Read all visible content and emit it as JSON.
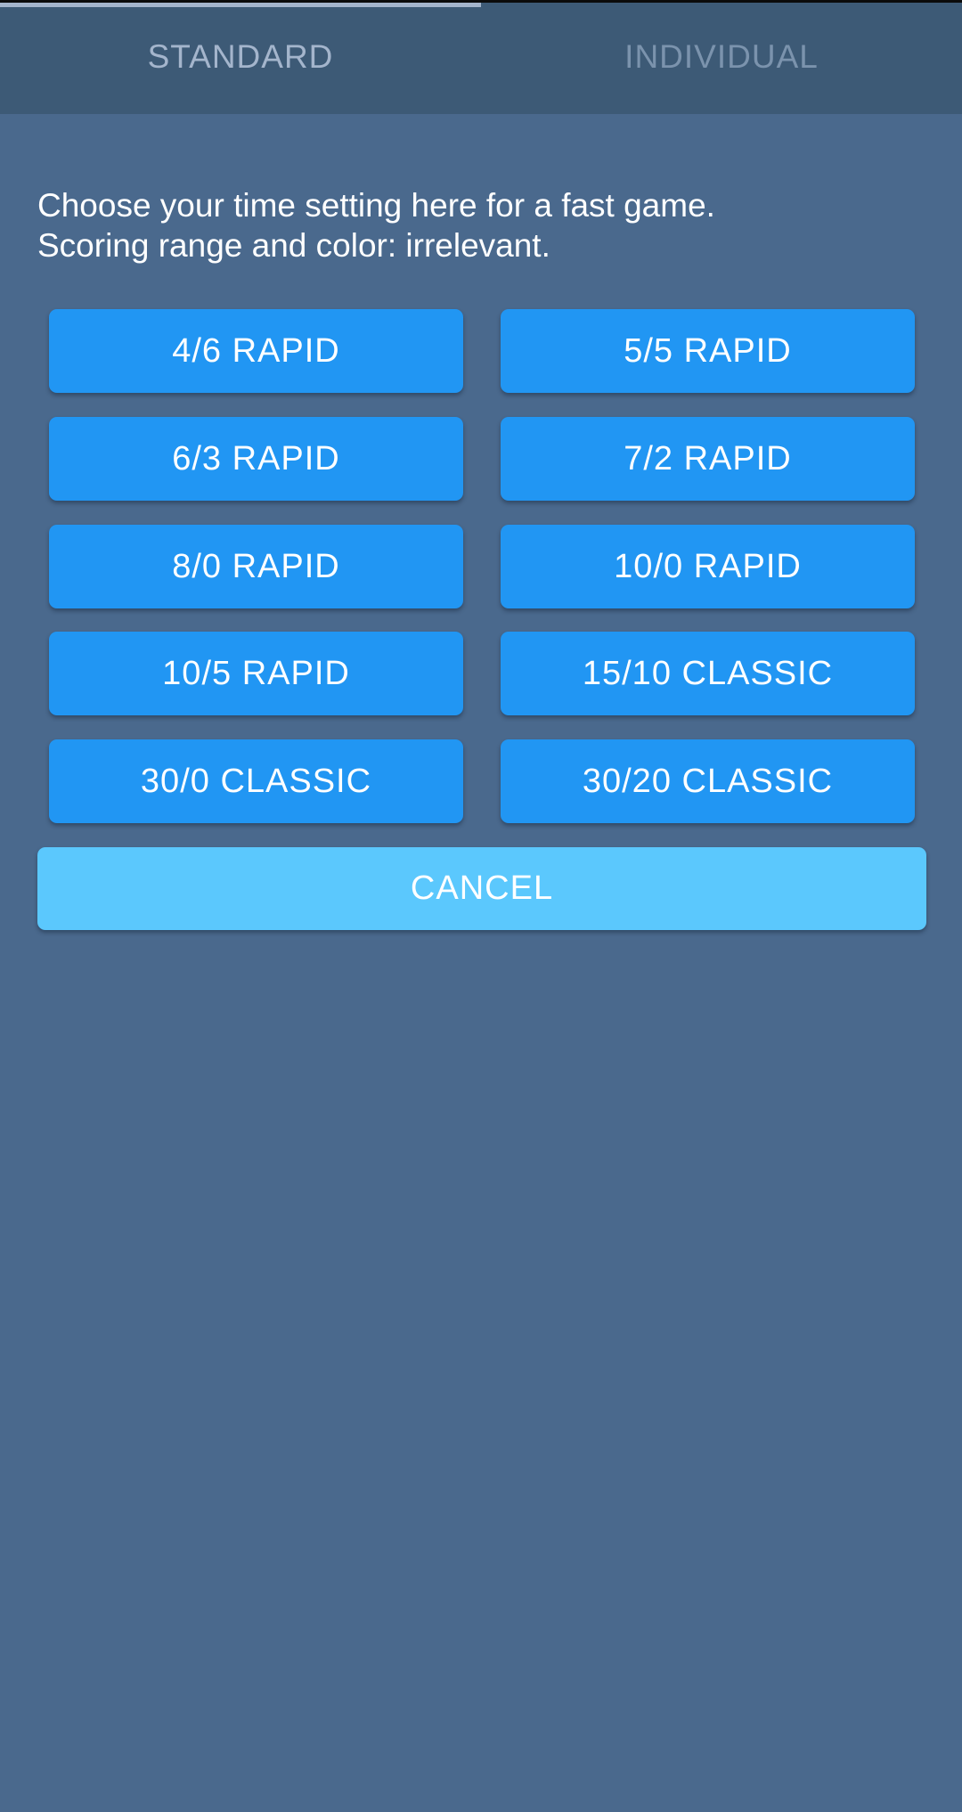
{
  "tabs": [
    {
      "label": "STANDARD",
      "active": true
    },
    {
      "label": "INDIVIDUAL",
      "active": false
    }
  ],
  "intro": {
    "line1": "Choose your time setting here for a fast game.",
    "line2": "Scoring range and color: irrelevant."
  },
  "time_options": [
    {
      "label": "4/6 RAPID"
    },
    {
      "label": "5/5 RAPID"
    },
    {
      "label": "6/3 RAPID"
    },
    {
      "label": "7/2 RAPID"
    },
    {
      "label": "8/0 RAPID"
    },
    {
      "label": "10/0 RAPID"
    },
    {
      "label": "10/5 RAPID"
    },
    {
      "label": "15/10 CLASSIC"
    },
    {
      "label": "30/0 CLASSIC"
    },
    {
      "label": "30/20 CLASSIC"
    }
  ],
  "cancel_label": "CANCEL",
  "colors": {
    "background": "#4a698d",
    "tab_bar": "#3d5a76",
    "option_button": "#2196f3",
    "cancel_button": "#5bc8fd"
  }
}
